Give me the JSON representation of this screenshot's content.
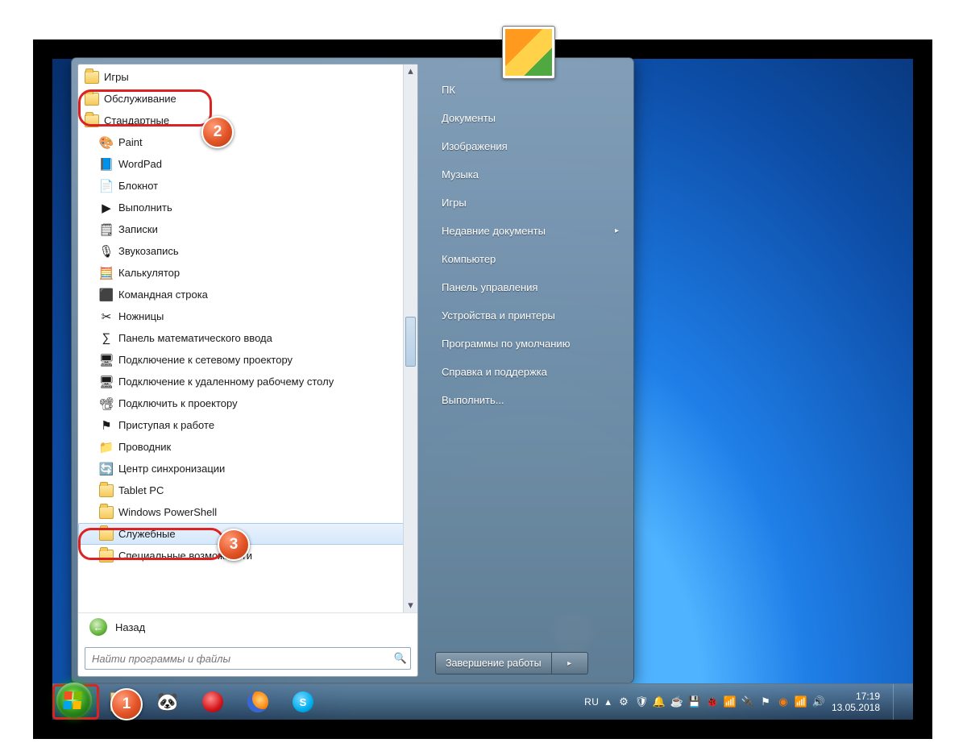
{
  "start_menu": {
    "programs": {
      "top_folders": [
        {
          "label": "Игры"
        },
        {
          "label": "Обслуживание"
        }
      ],
      "accessories_folder": "Стандартные",
      "accessories_items": [
        {
          "label": "Paint",
          "icon": "🎨"
        },
        {
          "label": "WordPad",
          "icon": "📘"
        },
        {
          "label": "Блокнот",
          "icon": "📄"
        },
        {
          "label": "Выполнить",
          "icon": "▶"
        },
        {
          "label": "Записки",
          "icon": "🗒"
        },
        {
          "label": "Звукозапись",
          "icon": "🎙"
        },
        {
          "label": "Калькулятор",
          "icon": "🧮"
        },
        {
          "label": "Командная строка",
          "icon": "⬛"
        },
        {
          "label": "Ножницы",
          "icon": "✂"
        },
        {
          "label": "Панель математического ввода",
          "icon": "∑"
        },
        {
          "label": "Подключение к сетевому проектору",
          "icon": "🖥"
        },
        {
          "label": "Подключение к удаленному рабочему столу",
          "icon": "🖥"
        },
        {
          "label": "Подключить к проектору",
          "icon": "📽"
        },
        {
          "label": "Приступая к работе",
          "icon": "⚑"
        },
        {
          "label": "Проводник",
          "icon": "📁"
        },
        {
          "label": "Центр синхронизации",
          "icon": "🔄"
        }
      ],
      "sub_folders": [
        {
          "label": "Tablet PC"
        },
        {
          "label": "Windows PowerShell"
        },
        {
          "label": "Служебные"
        },
        {
          "label": "Специальные возможности"
        }
      ],
      "back_label": "Назад",
      "search_placeholder": "Найти программы и файлы"
    },
    "right_links": [
      "ПК",
      "Документы",
      "Изображения",
      "Музыка",
      "Игры",
      "Недавние документы",
      "Компьютер",
      "Панель управления",
      "Устройства и принтеры",
      "Программы по умолчанию",
      "Справка и поддержка",
      "Выполнить..."
    ],
    "right_link_expand_index": 5,
    "shutdown_label": "Завершение работы"
  },
  "taskbar": {
    "lang": "RU",
    "time": "17:19",
    "date": "13.05.2018"
  },
  "callouts": {
    "1": "1",
    "2": "2",
    "3": "3"
  }
}
